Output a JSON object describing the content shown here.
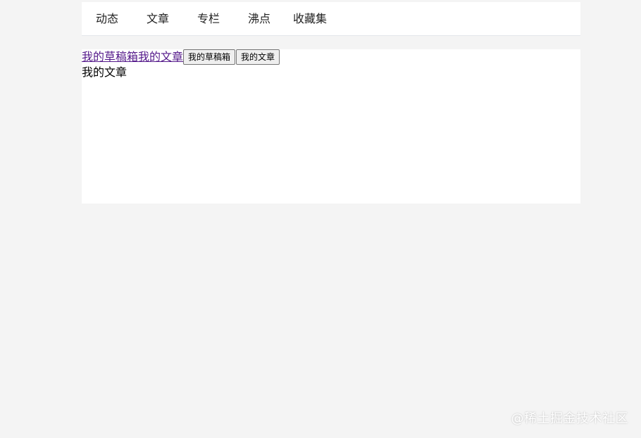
{
  "nav": {
    "items": [
      {
        "label": "动态"
      },
      {
        "label": "文章"
      },
      {
        "label": "专栏"
      },
      {
        "label": "沸点"
      },
      {
        "label": "收藏集"
      }
    ]
  },
  "content": {
    "links": [
      {
        "label": "我的草稿箱"
      },
      {
        "label": "我的文章"
      }
    ],
    "buttons": [
      {
        "label": "我的草稿箱"
      },
      {
        "label": "我的文章"
      }
    ],
    "current_view_text": "我的文章"
  },
  "watermark": {
    "text": "@稀土掘金技术社区"
  },
  "colors": {
    "page_background": "#f4f4f4",
    "panel_background": "#ffffff",
    "visited_link": "#551a8b",
    "button_background": "#efefef"
  }
}
